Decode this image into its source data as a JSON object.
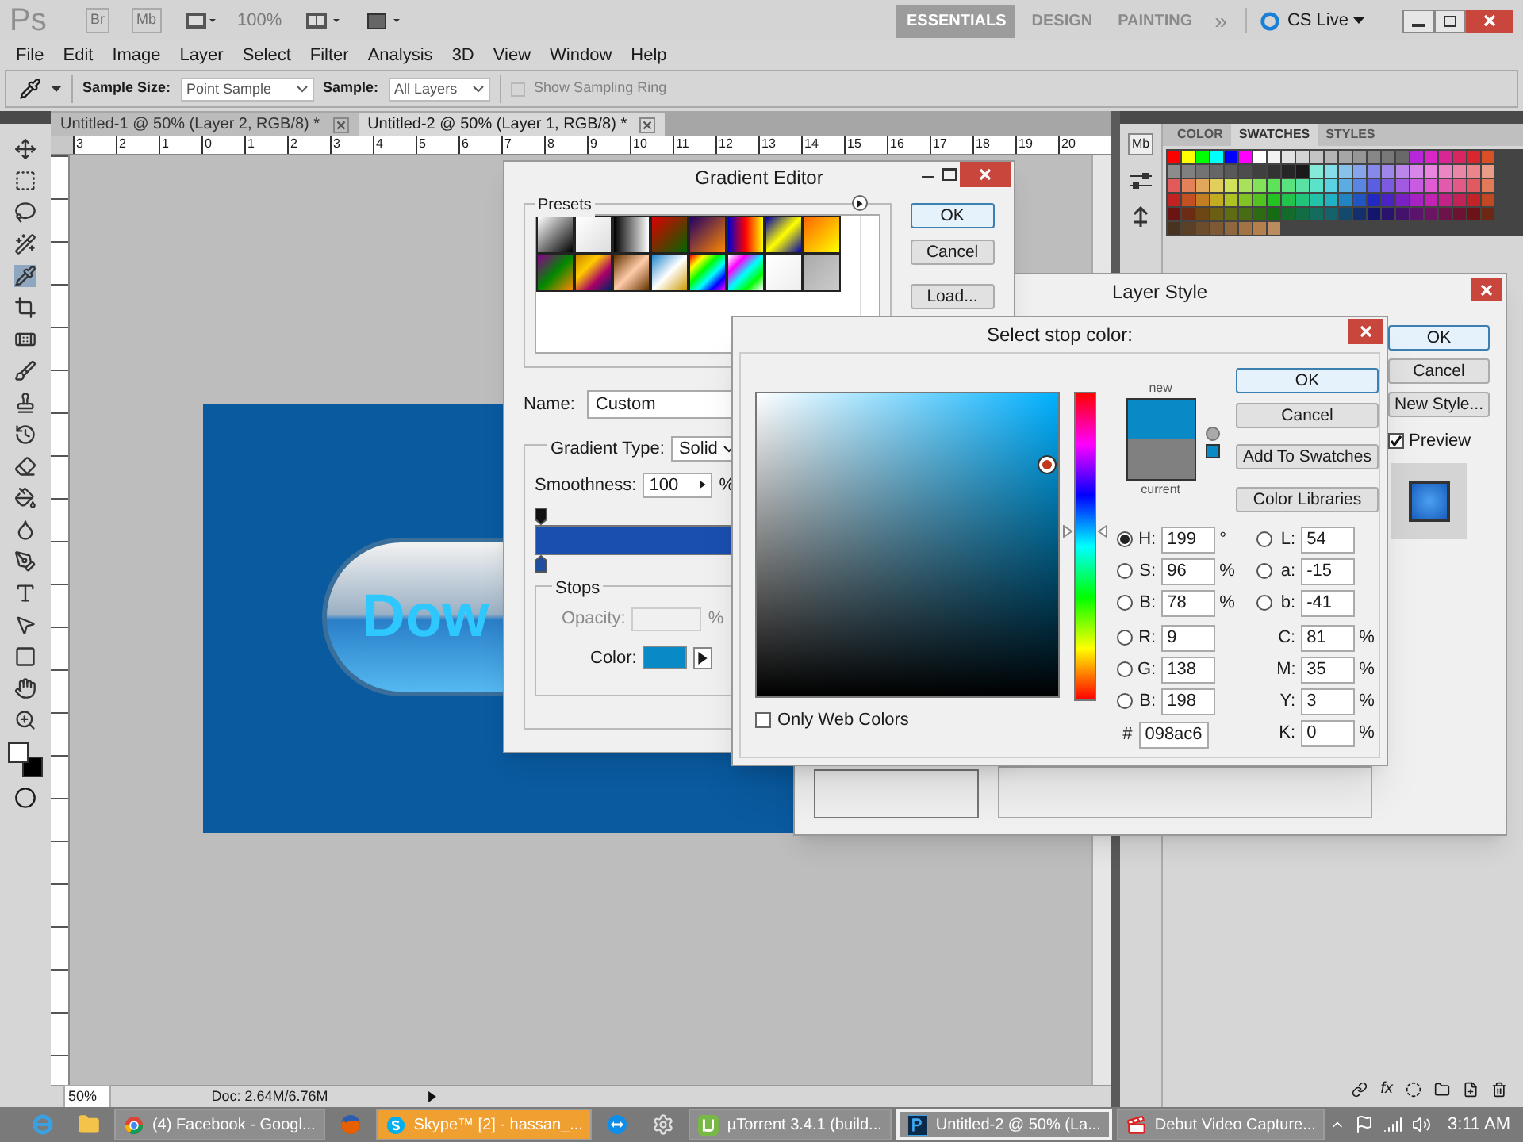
{
  "app_bar": {
    "logo": "Ps",
    "bridge": "Br",
    "mini_bridge": "Mb",
    "zoom": "100%",
    "workspaces": [
      {
        "label": "ESSENTIALS",
        "selected": true
      },
      {
        "label": "DESIGN",
        "selected": false
      },
      {
        "label": "PAINTING",
        "selected": false
      }
    ],
    "more": "»",
    "cs_live": "CS Live"
  },
  "menu": [
    "File",
    "Edit",
    "Image",
    "Layer",
    "Select",
    "Filter",
    "Analysis",
    "3D",
    "View",
    "Window",
    "Help"
  ],
  "options_bar": {
    "sample_size_label": "Sample Size:",
    "sample_size": "Point Sample",
    "sample_label": "Sample:",
    "sample": "All Layers",
    "sampling_ring": {
      "label": "Show Sampling Ring",
      "checked": false,
      "disabled": true
    }
  },
  "document_tabs": [
    {
      "label": "Untitled-1 @ 50% (Layer 2, RGB/8) *",
      "selected": false
    },
    {
      "label": "Untitled-2 @ 50% (Layer 1, RGB/8) *",
      "selected": true
    }
  ],
  "ruler_marks": [
    "3",
    "2",
    "1",
    "0",
    "1",
    "2",
    "3",
    "4",
    "5",
    "6",
    "7",
    "8",
    "9",
    "10",
    "11",
    "12",
    "13",
    "14",
    "15",
    "16",
    "17",
    "18",
    "19",
    "20"
  ],
  "canvas_text": "Dow",
  "status_bar": {
    "zoom": "50%",
    "doc": "Doc: 2.64M/6.76M"
  },
  "panel_dock": {
    "mini_bridge": "Mb"
  },
  "panel_tabs": [
    {
      "label": "COLOR",
      "selected": false
    },
    {
      "label": "SWATCHES",
      "selected": true
    },
    {
      "label": "STYLES",
      "selected": false
    }
  ],
  "panel_footer": {
    "fx": "fx"
  },
  "gradient_editor": {
    "title": "Gradient Editor",
    "presets_label": "Presets",
    "buttons": [
      "OK",
      "Cancel",
      "Load..."
    ],
    "name_label": "Name:",
    "name": "Custom",
    "type_label": "Gradient Type:",
    "type": "Solid",
    "smoothness_label": "Smoothness:",
    "smoothness": "100",
    "smoothness_unit": "%",
    "stops_label": "Stops",
    "opacity_label": "Opacity:",
    "opacity_unit": "%",
    "opacity_disabled": true,
    "color_label": "Color:",
    "stop": {
      "color": "#098ac6"
    }
  },
  "layer_style": {
    "title": "Layer Style",
    "buttons": [
      "OK",
      "Cancel",
      "New Style..."
    ],
    "preview": {
      "label": "Preview",
      "checked": true
    }
  },
  "color_picker": {
    "title": "Select stop color:",
    "new_label": "new",
    "current_label": "current",
    "new_swatch": {
      "color": "#098ac6"
    },
    "current_swatch": {
      "color": "#808080"
    },
    "hue_slider": {
      "level": 0.55
    },
    "buttons": [
      "OK",
      "Cancel",
      "Add To Swatches",
      "Color Libraries"
    ],
    "left_fields": [
      {
        "label": "H:",
        "value": "199",
        "unit": "°",
        "selected": true
      },
      {
        "label": "S:",
        "value": "96",
        "unit": "%",
        "selected": false
      },
      {
        "label": "B:",
        "value": "78",
        "unit": "%",
        "selected": false
      },
      {
        "label": "R:",
        "value": "9",
        "selected": false
      },
      {
        "label": "G:",
        "value": "138",
        "selected": false
      },
      {
        "label": "B:",
        "value": "198",
        "selected": false
      }
    ],
    "right_fields": [
      {
        "label": "L:",
        "value": "54",
        "selected": false
      },
      {
        "label": "a:",
        "value": "-15",
        "selected": false
      },
      {
        "label": "b:",
        "value": "-41",
        "selected": false
      },
      {
        "label": "C:",
        "value": "81",
        "unit": "%"
      },
      {
        "label": "M:",
        "value": "35",
        "unit": "%"
      },
      {
        "label": "Y:",
        "value": "3",
        "unit": "%"
      },
      {
        "label": "K:",
        "value": "0",
        "unit": "%"
      }
    ],
    "hex_label": "#",
    "hex": "098ac6",
    "web_colors": {
      "label": "Only Web Colors",
      "checked": false
    }
  },
  "taskbar": {
    "items": [
      {
        "kind": "ie",
        "selected": false,
        "flashing": false
      },
      {
        "kind": "explorer",
        "selected": false,
        "flashing": false
      },
      {
        "kind": "chrome",
        "label": "(4) Facebook - Googl...",
        "selected": false,
        "flashing": false
      },
      {
        "kind": "firefox",
        "selected": false,
        "flashing": false
      },
      {
        "kind": "skype",
        "label": "Skype™ [2] - hassan_...",
        "selected": false,
        "flashing": true
      },
      {
        "kind": "teamviewer",
        "selected": false,
        "flashing": false
      },
      {
        "kind": "gear",
        "selected": false,
        "flashing": false
      },
      {
        "kind": "utorrent",
        "label": "µTorrent 3.4.1  (build...",
        "selected": false,
        "flashing": false
      },
      {
        "kind": "photoshop",
        "label": "Untitled-2 @ 50% (La...",
        "selected": true,
        "flashing": false
      },
      {
        "kind": "debut",
        "label": "Debut Video Capture...",
        "selected": false,
        "flashing": false
      }
    ],
    "clock": "3:11 AM"
  }
}
